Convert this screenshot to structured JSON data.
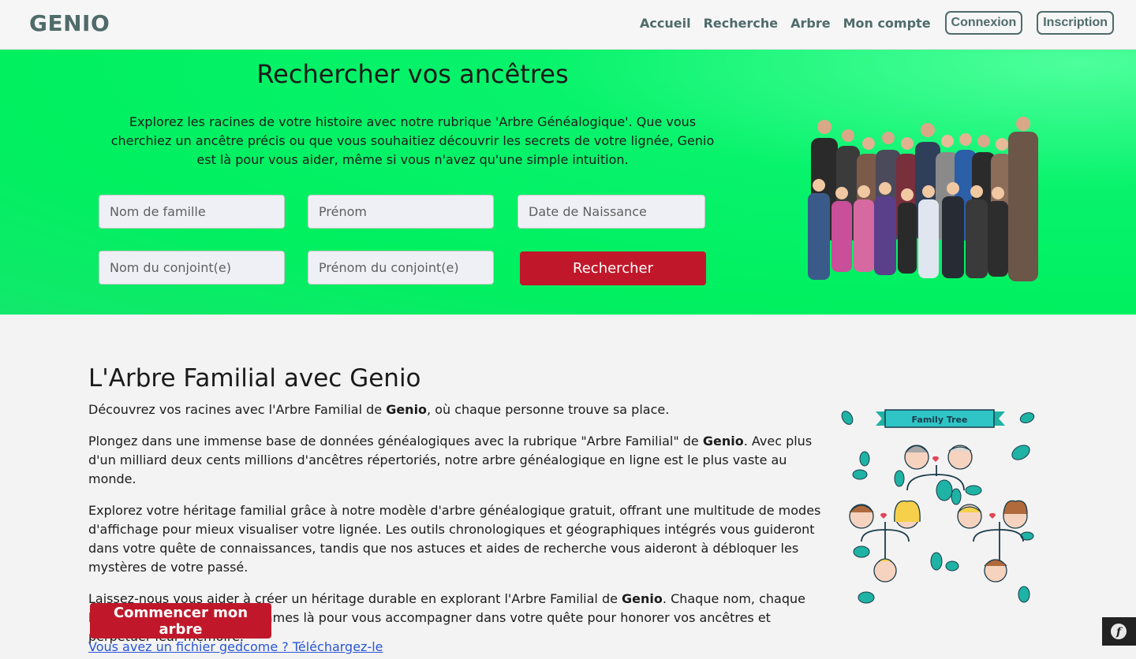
{
  "nav": {
    "brand": "GENIO",
    "links": [
      "Accueil",
      "Recherche",
      "Arbre",
      "Mon compte"
    ],
    "login": "Connexion",
    "signup": "Inscription"
  },
  "hero": {
    "title": "Rechercher vos ancêtres",
    "text": "Explorez les racines de votre histoire avec notre rubrique 'Arbre Généalogique'. Que vous cherchiez un ancêtre précis ou que vous souhaitiez découvrir les secrets de votre lignée, Genio est là pour vous aider, même si vous n'avez qu'une simple intuition.",
    "placeholders": {
      "nom": "Nom de famille",
      "prenom": "Prénom",
      "date": "Date de Naissance",
      "nom_conjoint": "Nom du conjoint(e)",
      "prenom_conjoint": "Prénom du conjoint(e)"
    },
    "search_label": "Rechercher"
  },
  "section": {
    "title": "L'Arbre Familial avec Genio",
    "p1_a": "Découvrez vos racines avec l'Arbre Familial de ",
    "p1_b": "Genio",
    "p1_c": ", où chaque personne trouve sa place.",
    "p2_a": "Plongez dans une immense base de données généalogiques avec la rubrique \"Arbre Familial\" de ",
    "p2_b": "Genio",
    "p2_c": ". Avec plus d'un milliard deux cents millions d'ancêtres répertoriés, notre arbre généalogique en ligne est le plus vaste au monde.",
    "p3": "Explorez votre héritage familial grâce à notre modèle d'arbre généalogique gratuit, offrant une multitude de modes d'affichage pour mieux visualiser votre lignée. Les outils chronologiques et géographiques intégrés vous guideront dans votre quête de connaissances, tandis que nos astuces et aides de recherche vous aideront à débloquer les mystères de votre passé.",
    "p4_a": "Laissez-nous vous aider à créer un héritage durable en explorant l'Arbre Familial de ",
    "p4_b": "Genio",
    "p4_c": ". Chaque nom, chaque histoire compte, et nous sommes là pour vous accompagner dans votre quête pour honorer vos ancêtres et perpétuer leur mémoire.",
    "cta": "Commencer mon arbre",
    "gedcom_link": "Vous avez un fichier gedcome ? Téléchargez-le"
  },
  "illustration": {
    "banner": "Family Tree"
  },
  "colors": {
    "accent": "#c0182a",
    "brand": "#4f6b6a",
    "hero": "#00f060",
    "leaf": "#1eb3a4"
  }
}
